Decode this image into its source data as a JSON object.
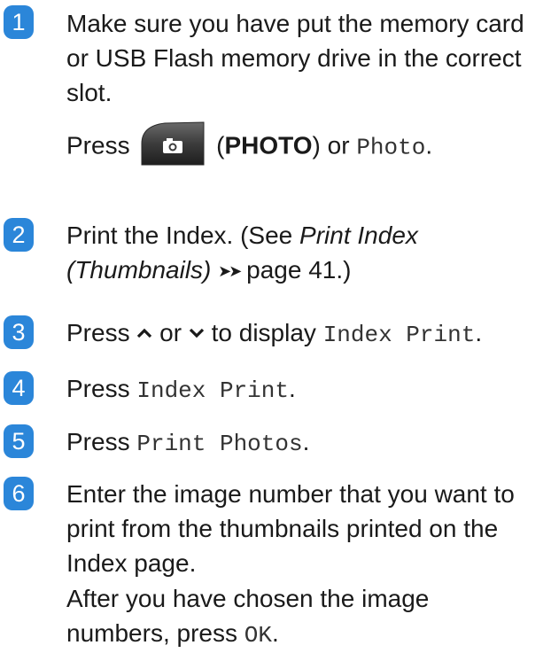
{
  "accent_color": "#2b86d9",
  "steps": [
    {
      "number": "1",
      "text": "Make sure you have put the memory card or USB Flash memory drive in the correct slot.",
      "press_word": "Press",
      "photo_button_icon": "camera-icon",
      "open_paren": "(",
      "photo_label": "PHOTO",
      "close_paren": ")",
      "or_word": "or",
      "photo_menu": "Photo",
      "end": "."
    },
    {
      "number": "2",
      "text_a": "Print the Index. (See",
      "ref_title": "Print Index (Thumbnails)",
      "arrows": "➤➤",
      "page_ref": "page 41.)"
    },
    {
      "number": "3",
      "press_word": "Press",
      "up_icon": "chevron-up-icon",
      "or_word": "or",
      "down_icon": "chevron-down-icon",
      "text_b": "to display",
      "menu": "Index Print",
      "end": "."
    },
    {
      "number": "4",
      "press_word": "Press",
      "menu": "Index Print",
      "end": "."
    },
    {
      "number": "5",
      "press_word": "Press",
      "menu": "Print Photos",
      "end": "."
    },
    {
      "number": "6",
      "text": "Enter the image number that you want to print from the thumbnails printed on the Index page.",
      "text_b": "After you have chosen the image numbers, press",
      "ok_key": "OK",
      "end": "."
    }
  ]
}
